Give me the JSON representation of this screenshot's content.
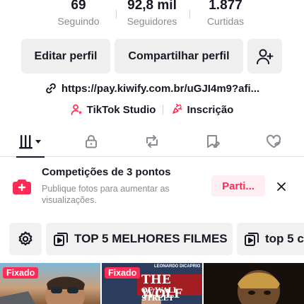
{
  "stats": [
    {
      "value": "69",
      "label": "Seguindo"
    },
    {
      "value": "92,8 mil",
      "label": "Seguidores"
    },
    {
      "value": "1.877",
      "label": "Curtidas"
    }
  ],
  "actions": {
    "edit_profile": "Editar perfil",
    "share_profile": "Compartilhar perfil",
    "add_friend_icon": "add-user-icon"
  },
  "bio_link": "https://pay.kiwify.com.br/uGJI4m9?afi...",
  "tools": {
    "studio": "TikTok Studio",
    "subscription": "Inscrição"
  },
  "tabs": [
    {
      "icon": "videos-grid-icon",
      "active": true
    },
    {
      "icon": "lock-icon",
      "active": false
    },
    {
      "icon": "repost-icon",
      "active": false
    },
    {
      "icon": "favorites-icon",
      "active": false
    },
    {
      "icon": "liked-icon",
      "active": false
    }
  ],
  "promo": {
    "title": "Competições de 3 pontos",
    "subtitle": "Publique fotos para aumentar as visualizações.",
    "button": "Parti...",
    "accent": "#fe2c55"
  },
  "playlists": [
    {
      "label": "TOP 5 MELHORES FILMES"
    },
    {
      "label": "top 5 c"
    }
  ],
  "videos": [
    {
      "badge": "Fixado"
    },
    {
      "badge": "Fixado",
      "caption_small": "LEONARDO DICAPRIO",
      "caption_big": "THE WOLF",
      "caption_sub": "OF WALL STREET"
    },
    {
      "badge": ""
    }
  ]
}
